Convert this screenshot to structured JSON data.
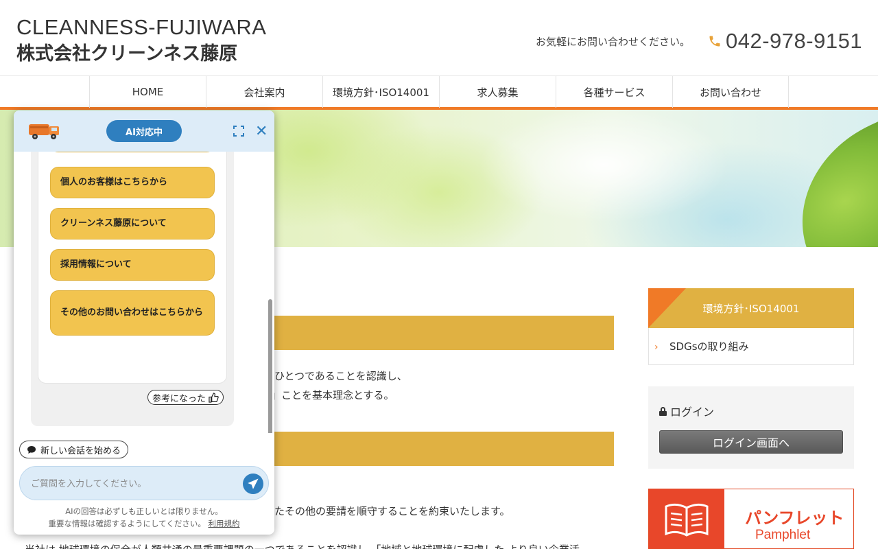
{
  "header": {
    "logo_en": "CLEANNESS-FUJIWARA",
    "logo_ja": "株式会社クリーンネス藤原",
    "contact_note": "お気軽にお問い合わせください。",
    "phone": "042-978-9151"
  },
  "nav": {
    "items": [
      {
        "label": "HOME"
      },
      {
        "label": "会社案内"
      },
      {
        "label": "環境方針･ISO14001"
      },
      {
        "label": "求人募集"
      },
      {
        "label": "各種サービス"
      },
      {
        "label": "お問い合わせ"
      }
    ]
  },
  "content": {
    "line1": "ひとつであることを認識し、",
    "line2": "」ことを基本理念とする。",
    "line3": "たその他の要請を順守することを約束いたします。",
    "line4": "当社は 地球環境の保全が人類共通の最重要課題の一つであることを認識し 「地域と地球環境に配慮した より良い企業活"
  },
  "sidebar": {
    "section_title": "環境方針･ISO14001",
    "link": "SDGsの取り組み",
    "login_label": "ログイン",
    "login_button": "ログイン画面へ",
    "pamphlet_title": "パンフレット",
    "pamphlet_sub": "Pamphlet"
  },
  "chat": {
    "badge": "AI対応中",
    "choices": [
      "個人のお客様はこちらから",
      "クリーンネス藤原について",
      "採用情報について",
      "その他のお問い合わせはこちらから"
    ],
    "helpful": "参考になった",
    "new_chat": "新しい会話を始める",
    "input_placeholder": "ご質問を入力してください。",
    "disclaimer1": "AIの回答は必ずしも正しいとは限りません。",
    "disclaimer2": "重要な情報は確認するようにしてください。",
    "terms": "利用規約"
  },
  "colors": {
    "accent_orange": "#f07a27",
    "gold": "#e0b142",
    "chat_blue": "#2f7fbf",
    "choice_yellow": "#f2c44f"
  }
}
